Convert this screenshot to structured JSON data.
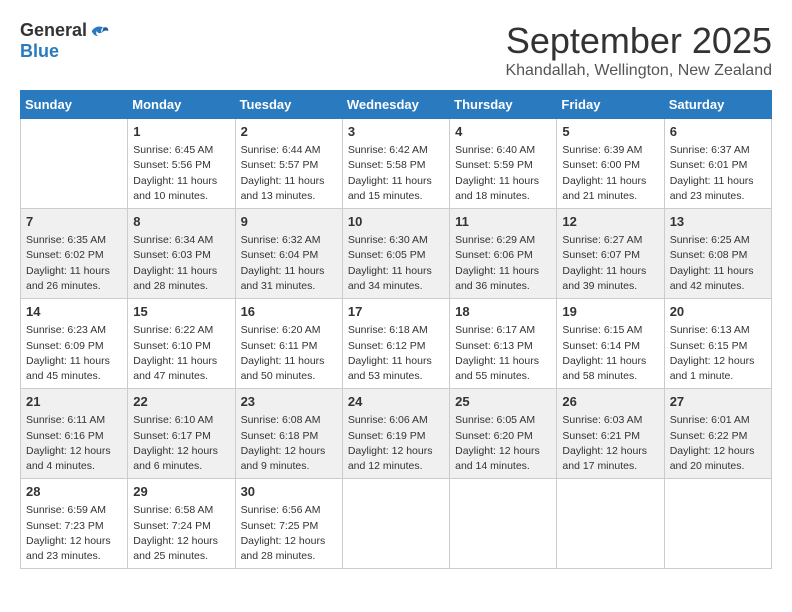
{
  "logo": {
    "general": "General",
    "blue": "Blue"
  },
  "title": "September 2025",
  "subtitle": "Khandallah, Wellington, New Zealand",
  "days": [
    "Sunday",
    "Monday",
    "Tuesday",
    "Wednesday",
    "Thursday",
    "Friday",
    "Saturday"
  ],
  "weeks": [
    [
      {
        "day": "",
        "sunrise": "",
        "sunset": "",
        "daylight": ""
      },
      {
        "day": "1",
        "sunrise": "Sunrise: 6:45 AM",
        "sunset": "Sunset: 5:56 PM",
        "daylight": "Daylight: 11 hours and 10 minutes."
      },
      {
        "day": "2",
        "sunrise": "Sunrise: 6:44 AM",
        "sunset": "Sunset: 5:57 PM",
        "daylight": "Daylight: 11 hours and 13 minutes."
      },
      {
        "day": "3",
        "sunrise": "Sunrise: 6:42 AM",
        "sunset": "Sunset: 5:58 PM",
        "daylight": "Daylight: 11 hours and 15 minutes."
      },
      {
        "day": "4",
        "sunrise": "Sunrise: 6:40 AM",
        "sunset": "Sunset: 5:59 PM",
        "daylight": "Daylight: 11 hours and 18 minutes."
      },
      {
        "day": "5",
        "sunrise": "Sunrise: 6:39 AM",
        "sunset": "Sunset: 6:00 PM",
        "daylight": "Daylight: 11 hours and 21 minutes."
      },
      {
        "day": "6",
        "sunrise": "Sunrise: 6:37 AM",
        "sunset": "Sunset: 6:01 PM",
        "daylight": "Daylight: 11 hours and 23 minutes."
      }
    ],
    [
      {
        "day": "7",
        "sunrise": "Sunrise: 6:35 AM",
        "sunset": "Sunset: 6:02 PM",
        "daylight": "Daylight: 11 hours and 26 minutes."
      },
      {
        "day": "8",
        "sunrise": "Sunrise: 6:34 AM",
        "sunset": "Sunset: 6:03 PM",
        "daylight": "Daylight: 11 hours and 28 minutes."
      },
      {
        "day": "9",
        "sunrise": "Sunrise: 6:32 AM",
        "sunset": "Sunset: 6:04 PM",
        "daylight": "Daylight: 11 hours and 31 minutes."
      },
      {
        "day": "10",
        "sunrise": "Sunrise: 6:30 AM",
        "sunset": "Sunset: 6:05 PM",
        "daylight": "Daylight: 11 hours and 34 minutes."
      },
      {
        "day": "11",
        "sunrise": "Sunrise: 6:29 AM",
        "sunset": "Sunset: 6:06 PM",
        "daylight": "Daylight: 11 hours and 36 minutes."
      },
      {
        "day": "12",
        "sunrise": "Sunrise: 6:27 AM",
        "sunset": "Sunset: 6:07 PM",
        "daylight": "Daylight: 11 hours and 39 minutes."
      },
      {
        "day": "13",
        "sunrise": "Sunrise: 6:25 AM",
        "sunset": "Sunset: 6:08 PM",
        "daylight": "Daylight: 11 hours and 42 minutes."
      }
    ],
    [
      {
        "day": "14",
        "sunrise": "Sunrise: 6:23 AM",
        "sunset": "Sunset: 6:09 PM",
        "daylight": "Daylight: 11 hours and 45 minutes."
      },
      {
        "day": "15",
        "sunrise": "Sunrise: 6:22 AM",
        "sunset": "Sunset: 6:10 PM",
        "daylight": "Daylight: 11 hours and 47 minutes."
      },
      {
        "day": "16",
        "sunrise": "Sunrise: 6:20 AM",
        "sunset": "Sunset: 6:11 PM",
        "daylight": "Daylight: 11 hours and 50 minutes."
      },
      {
        "day": "17",
        "sunrise": "Sunrise: 6:18 AM",
        "sunset": "Sunset: 6:12 PM",
        "daylight": "Daylight: 11 hours and 53 minutes."
      },
      {
        "day": "18",
        "sunrise": "Sunrise: 6:17 AM",
        "sunset": "Sunset: 6:13 PM",
        "daylight": "Daylight: 11 hours and 55 minutes."
      },
      {
        "day": "19",
        "sunrise": "Sunrise: 6:15 AM",
        "sunset": "Sunset: 6:14 PM",
        "daylight": "Daylight: 11 hours and 58 minutes."
      },
      {
        "day": "20",
        "sunrise": "Sunrise: 6:13 AM",
        "sunset": "Sunset: 6:15 PM",
        "daylight": "Daylight: 12 hours and 1 minute."
      }
    ],
    [
      {
        "day": "21",
        "sunrise": "Sunrise: 6:11 AM",
        "sunset": "Sunset: 6:16 PM",
        "daylight": "Daylight: 12 hours and 4 minutes."
      },
      {
        "day": "22",
        "sunrise": "Sunrise: 6:10 AM",
        "sunset": "Sunset: 6:17 PM",
        "daylight": "Daylight: 12 hours and 6 minutes."
      },
      {
        "day": "23",
        "sunrise": "Sunrise: 6:08 AM",
        "sunset": "Sunset: 6:18 PM",
        "daylight": "Daylight: 12 hours and 9 minutes."
      },
      {
        "day": "24",
        "sunrise": "Sunrise: 6:06 AM",
        "sunset": "Sunset: 6:19 PM",
        "daylight": "Daylight: 12 hours and 12 minutes."
      },
      {
        "day": "25",
        "sunrise": "Sunrise: 6:05 AM",
        "sunset": "Sunset: 6:20 PM",
        "daylight": "Daylight: 12 hours and 14 minutes."
      },
      {
        "day": "26",
        "sunrise": "Sunrise: 6:03 AM",
        "sunset": "Sunset: 6:21 PM",
        "daylight": "Daylight: 12 hours and 17 minutes."
      },
      {
        "day": "27",
        "sunrise": "Sunrise: 6:01 AM",
        "sunset": "Sunset: 6:22 PM",
        "daylight": "Daylight: 12 hours and 20 minutes."
      }
    ],
    [
      {
        "day": "28",
        "sunrise": "Sunrise: 6:59 AM",
        "sunset": "Sunset: 7:23 PM",
        "daylight": "Daylight: 12 hours and 23 minutes."
      },
      {
        "day": "29",
        "sunrise": "Sunrise: 6:58 AM",
        "sunset": "Sunset: 7:24 PM",
        "daylight": "Daylight: 12 hours and 25 minutes."
      },
      {
        "day": "30",
        "sunrise": "Sunrise: 6:56 AM",
        "sunset": "Sunset: 7:25 PM",
        "daylight": "Daylight: 12 hours and 28 minutes."
      },
      {
        "day": "",
        "sunrise": "",
        "sunset": "",
        "daylight": ""
      },
      {
        "day": "",
        "sunrise": "",
        "sunset": "",
        "daylight": ""
      },
      {
        "day": "",
        "sunrise": "",
        "sunset": "",
        "daylight": ""
      },
      {
        "day": "",
        "sunrise": "",
        "sunset": "",
        "daylight": ""
      }
    ]
  ]
}
